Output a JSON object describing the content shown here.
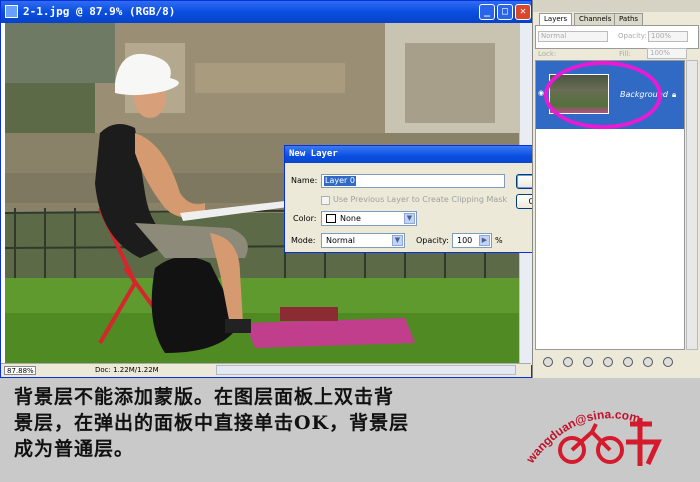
{
  "document": {
    "title": "2-1.jpg @ 87.9% (RGB/8)",
    "status": {
      "zoom": "87.88%",
      "doc_info": "Doc: 1.22M/1.22M"
    }
  },
  "dialog": {
    "title": "New Layer",
    "name_label": "Name:",
    "name_value": "Layer 0",
    "clipping_label": "Use Previous Layer to Create Clipping Mask",
    "color_label": "Color:",
    "color_value": "None",
    "mode_label": "Mode:",
    "mode_value": "Normal",
    "opacity_label": "Opacity:",
    "opacity_value": "100",
    "opacity_unit": "%",
    "ok_label": "OK",
    "cancel_label": "Cancel"
  },
  "layers_panel": {
    "tabs": [
      "Layers",
      "Channels",
      "Paths"
    ],
    "blend_mode": "Normal",
    "opacity_label": "Opacity:",
    "opacity_value": "100%",
    "lock_label": "Lock:",
    "fill_label": "Fill:",
    "fill_value": "100%",
    "layer_name": "Background",
    "highlight_color": "#e81ad6",
    "selection_color": "#316ac5"
  },
  "caption": {
    "line1": "背景层不能添加蒙版。在图层面板上双击背",
    "line2": "景层，在弹出的面板中直接单击OK，背景层",
    "line3": "成为普通层。"
  },
  "watermark": {
    "text": "wangduan@sina.com"
  }
}
